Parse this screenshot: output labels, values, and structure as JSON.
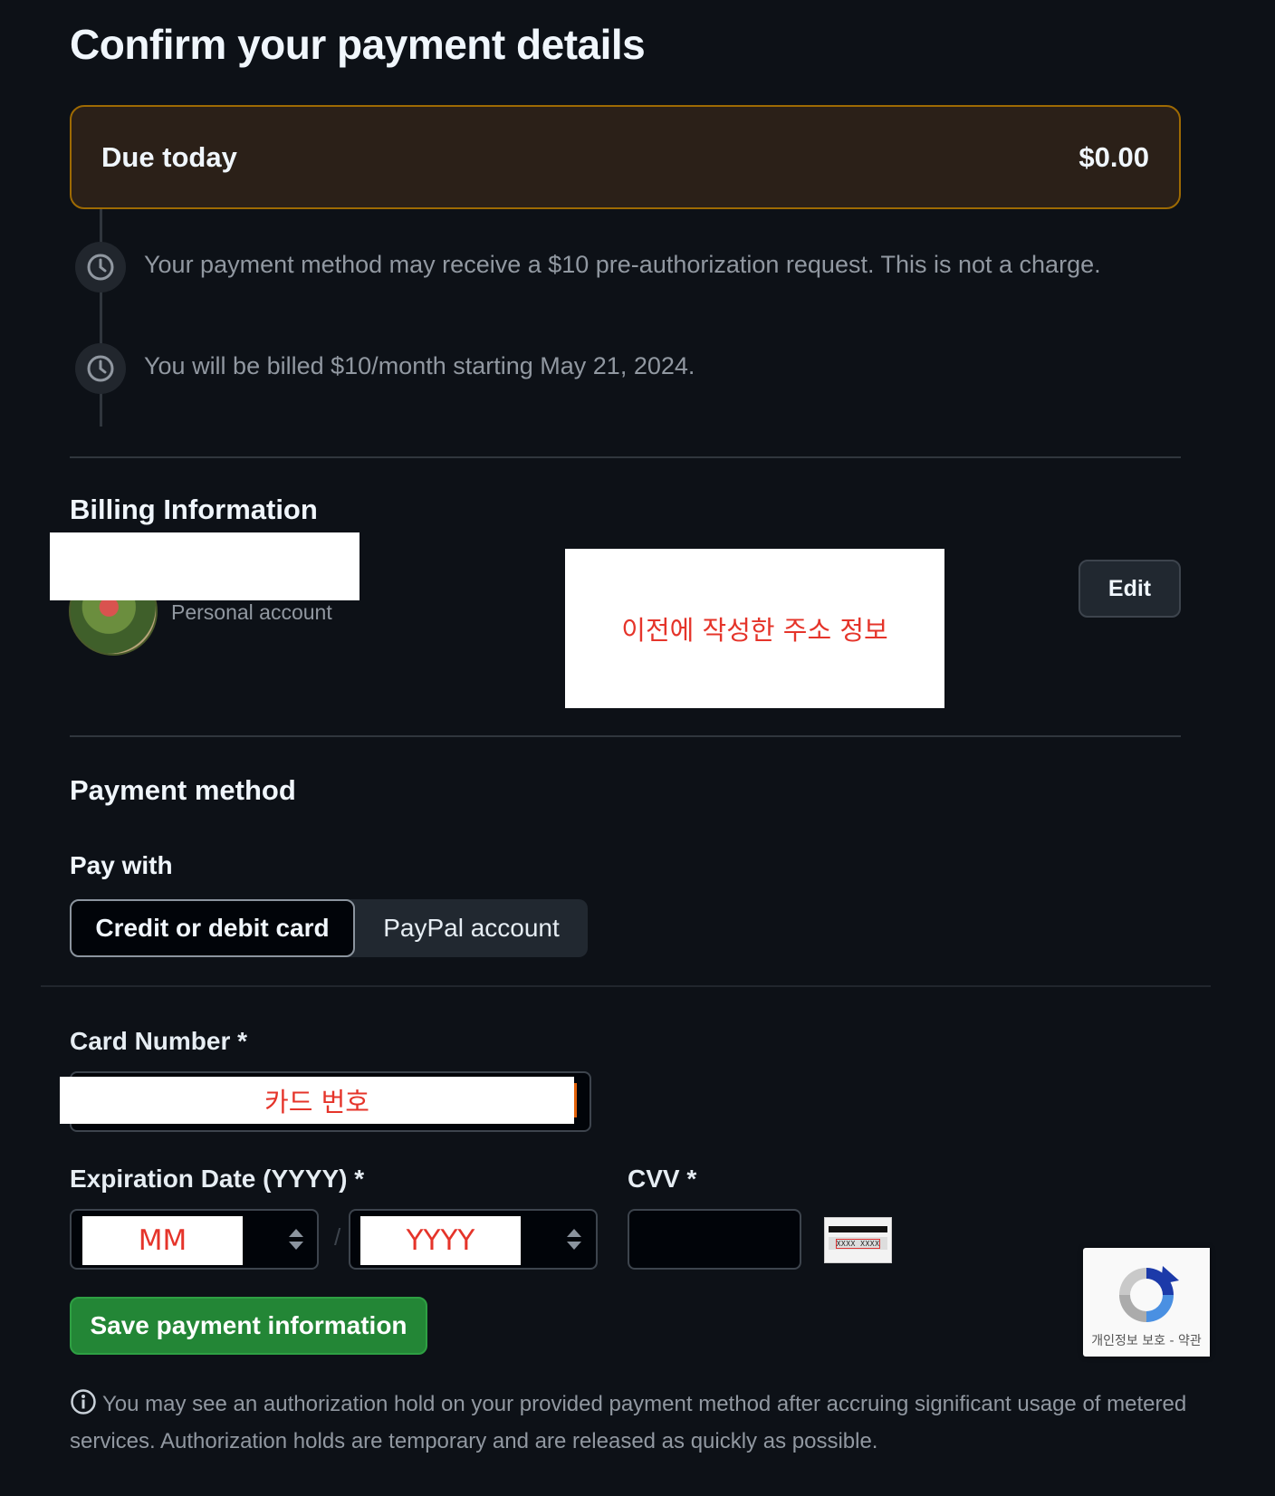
{
  "page": {
    "title": "Confirm your payment details"
  },
  "due": {
    "label": "Due today",
    "amount": "$0.00",
    "border_color": "#9e6a03"
  },
  "timeline": [
    {
      "icon": "clock-icon",
      "text": "Your payment method may receive a $10 pre-authorization request. This is not a charge."
    },
    {
      "icon": "clock-icon",
      "text": "You will be billed $10/month starting May 21, 2024."
    }
  ],
  "billing": {
    "heading": "Billing Information",
    "account_type": "Personal account",
    "address_overlay": "이전에 작성한 주소 정보",
    "edit_label": "Edit"
  },
  "payment": {
    "heading": "Payment method",
    "pay_with_label": "Pay with",
    "options": [
      "Credit or debit card",
      "PayPal account"
    ],
    "selected": "Credit or debit card"
  },
  "form": {
    "card_number_label": "Card Number *",
    "card_number_overlay": "카드 번호",
    "expiration_label": "Expiration Date (YYYY) *",
    "month_overlay": "MM",
    "year_overlay": "YYYY",
    "date_separator": "/",
    "cvv_label": "CVV *",
    "cvv_card_text": "XXXX XXXX",
    "save_label": "Save payment information"
  },
  "footer": {
    "note": "You may see an authorization hold on your provided payment method after accruing significant usage of metered services. Authorization holds are temporary and are released as quickly as possible."
  },
  "recaptcha": {
    "text": "개인정보 보호 - 약관"
  },
  "colors": {
    "background": "#0d1117",
    "accent_green": "#238636",
    "overlay_red": "#e5342a"
  }
}
